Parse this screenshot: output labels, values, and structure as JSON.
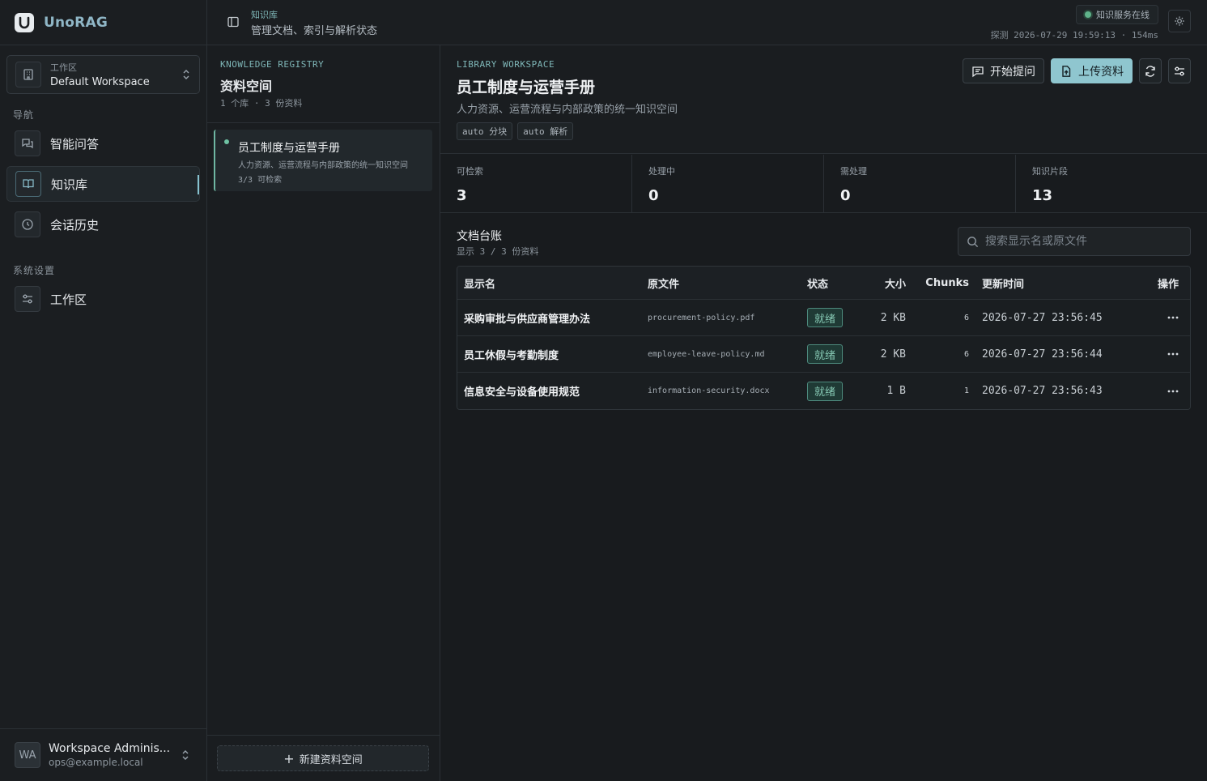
{
  "app": {
    "name": "UnoRAG"
  },
  "workspace": {
    "label": "工作区",
    "name": "Default Workspace"
  },
  "nav": {
    "section": "导航",
    "items": [
      {
        "label": "智能问答",
        "icon": "chat-icon"
      },
      {
        "label": "知识库",
        "icon": "book-icon",
        "active": true
      },
      {
        "label": "会话历史",
        "icon": "clock-icon"
      }
    ],
    "settings_section": "系统设置",
    "settings_items": [
      {
        "label": "工作区",
        "icon": "sliders-icon"
      }
    ]
  },
  "user": {
    "initials": "WA",
    "name": "Workspace Adminis...",
    "email": "ops@example.local"
  },
  "topbar": {
    "breadcrumb": "知识库",
    "subtitle": "管理文档、索引与解析状态",
    "status": "知识服务在线",
    "probe": "探测 2026-07-29 19:59:13 · 154ms"
  },
  "registry": {
    "eyebrow": "KNOWLEDGE REGISTRY",
    "title": "资料空间",
    "meta": "1 个库 · 3 份资料",
    "libraries": [
      {
        "name": "员工制度与运营手册",
        "desc": "人力资源、运营流程与内部政策的统一知识空间",
        "count": "3/3 可检索"
      }
    ],
    "new_button": "新建资料空间"
  },
  "library": {
    "eyebrow": "LIBRARY WORKSPACE",
    "title": "员工制度与运营手册",
    "subtitle": "人力资源、运营流程与内部政策的统一知识空间",
    "tags": [
      "auto 分块",
      "auto 解析"
    ],
    "actions": {
      "ask": "开始提问",
      "upload": "上传资料"
    }
  },
  "stats": [
    {
      "label": "可检索",
      "value": "3"
    },
    {
      "label": "处理中",
      "value": "0"
    },
    {
      "label": "需处理",
      "value": "0"
    },
    {
      "label": "知识片段",
      "value": "13"
    }
  ],
  "documents": {
    "title": "文档台账",
    "meta": "显示 3 / 3 份资料",
    "search_placeholder": "搜索显示名或原文件",
    "columns": {
      "name": "显示名",
      "file": "原文件",
      "status": "状态",
      "size": "大小",
      "chunks": "Chunks",
      "updated": "更新时间",
      "ops": "操作"
    },
    "rows": [
      {
        "name": "采购审批与供应商管理办法",
        "file": "procurement-policy.pdf",
        "status": "就绪",
        "size": "2 KB",
        "chunks": "6",
        "updated": "2026-07-27 23:56:45"
      },
      {
        "name": "员工休假与考勤制度",
        "file": "employee-leave-policy.md",
        "status": "就绪",
        "size": "2 KB",
        "chunks": "6",
        "updated": "2026-07-27 23:56:44"
      },
      {
        "name": "信息安全与设备使用规范",
        "file": "information-security.docx",
        "status": "就绪",
        "size": "1 B",
        "chunks": "1",
        "updated": "2026-07-27 23:56:43"
      }
    ]
  },
  "colors": {
    "accent": "#8fc6cf",
    "status_ok": "#5fb38a"
  }
}
